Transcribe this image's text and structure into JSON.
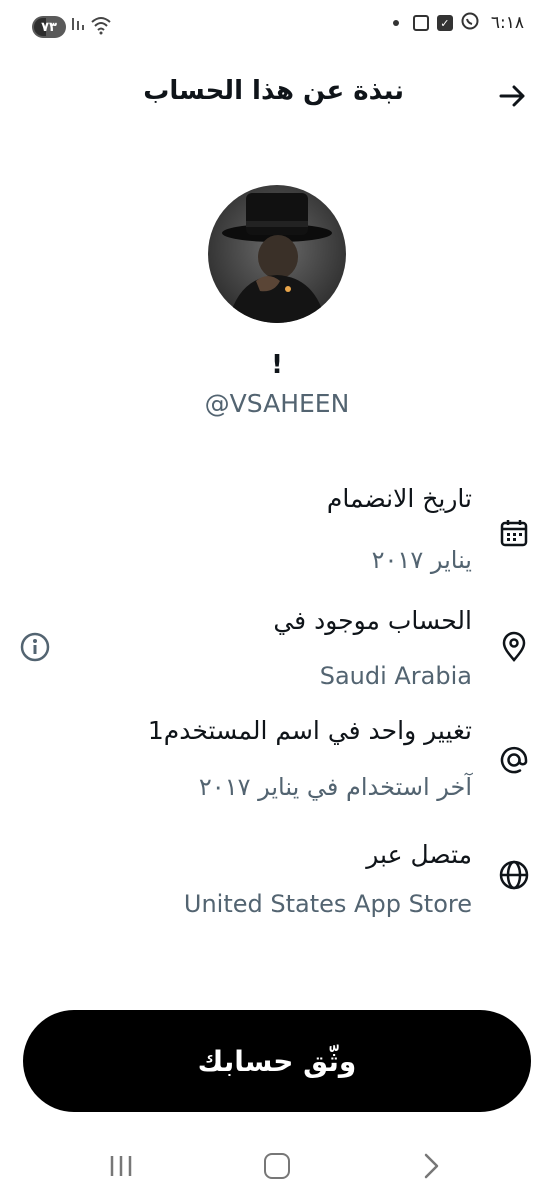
{
  "status_bar": {
    "battery": "٧٣",
    "time": "٦:١٨"
  },
  "header": {
    "title": "نبذة عن هذا الحساب"
  },
  "profile": {
    "display_name": "!",
    "handle": "@VSAHEEN"
  },
  "rows": [
    {
      "title": "تاريخ الانضمام",
      "value": "يناير ٢٠١٧",
      "icon": "calendar-icon"
    },
    {
      "title": "الحساب موجود في",
      "value": "Saudi Arabia",
      "icon": "location-pin-icon"
    },
    {
      "title": "تغيير واحد في اسم المستخدم1",
      "value": "آخر استخدام في يناير ٢٠١٧",
      "icon": "at-sign-icon"
    },
    {
      "title": "متصل عبر",
      "value": "United States App Store",
      "icon": "globe-icon"
    }
  ],
  "verify_button": {
    "label": "وثّق حسابك"
  }
}
